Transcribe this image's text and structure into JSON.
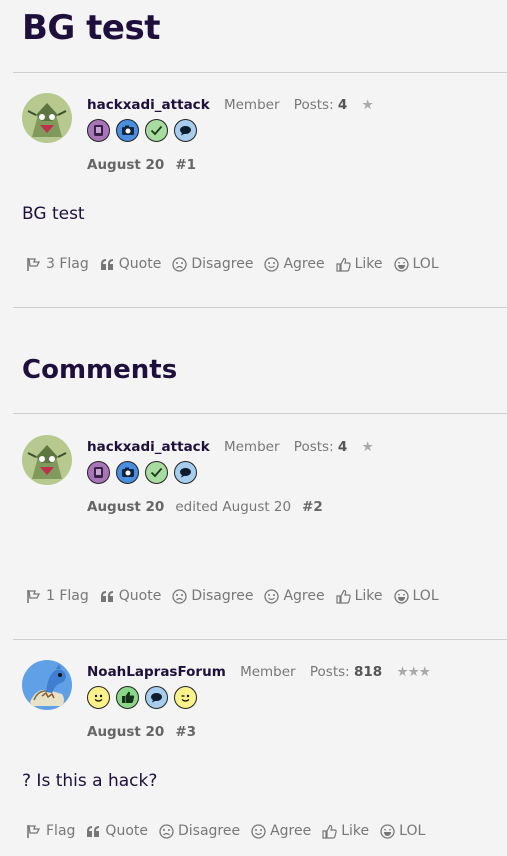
{
  "page": {
    "title": "BG test",
    "comments_heading": "Comments"
  },
  "posts": [
    {
      "username": "hackxadi_attack",
      "role": "Member",
      "posts_label": "Posts:",
      "posts_count": "4",
      "stars": "★",
      "date": "August 20",
      "edited": "",
      "number": "#1",
      "body": "BG test",
      "reactions": {
        "flag": "3 Flag",
        "quote": "Quote",
        "disagree": "Disagree",
        "agree": "Agree",
        "like": "Like",
        "lol": "LOL"
      }
    },
    {
      "username": "hackxadi_attack",
      "role": "Member",
      "posts_label": "Posts:",
      "posts_count": "4",
      "stars": "★",
      "date": "August 20",
      "edited": "edited August 20",
      "number": "#2",
      "body": "",
      "reactions": {
        "flag": "1 Flag",
        "quote": "Quote",
        "disagree": "Disagree",
        "agree": "Agree",
        "like": "Like",
        "lol": "LOL"
      }
    },
    {
      "username": "NoahLaprasForum",
      "role": "Member",
      "posts_label": "Posts:",
      "posts_count": "818",
      "stars": "★★★",
      "date": "August 20",
      "edited": "",
      "number": "#3",
      "body": "? Is this a hack?",
      "reactions": {
        "flag": "Flag",
        "quote": "Quote",
        "disagree": "Disagree",
        "agree": "Agree",
        "like": "Like",
        "lol": "LOL"
      }
    }
  ],
  "colors": {
    "accent": "#1e0f3c",
    "muted": "#777777",
    "divider": "#cfcfcf",
    "background": "#f4f4f4"
  }
}
